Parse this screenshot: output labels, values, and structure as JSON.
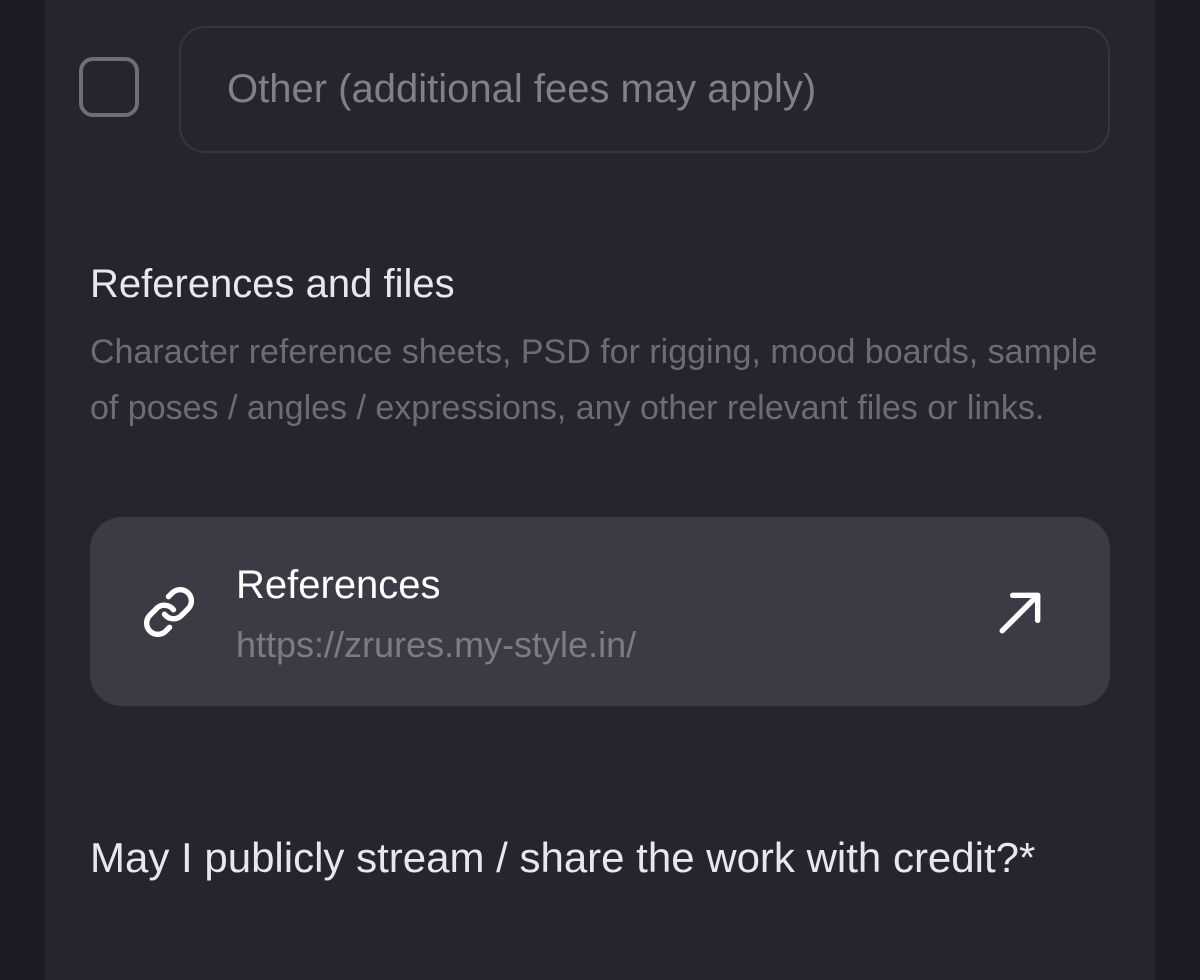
{
  "other_option": {
    "checked": false,
    "placeholder": "Other (additional fees may apply)",
    "value": ""
  },
  "references_section": {
    "heading": "References and files",
    "description": "Character reference sheets, PSD for rigging, mood boards, sample of poses / angles / expressions, any other relevant files or links."
  },
  "reference_link": {
    "title": "References",
    "url": "https://zrures.my-style.in/",
    "leading_icon": "link-icon",
    "trailing_icon": "arrow-up-right-icon"
  },
  "stream_question": {
    "label": "May I publicly stream / share the work with credit?*"
  },
  "colors": {
    "background": "#1c1c25",
    "panel": "#252530",
    "card": "#3b3b45",
    "text_primary": "#e8e8ec",
    "text_secondary": "#6c6c76"
  }
}
